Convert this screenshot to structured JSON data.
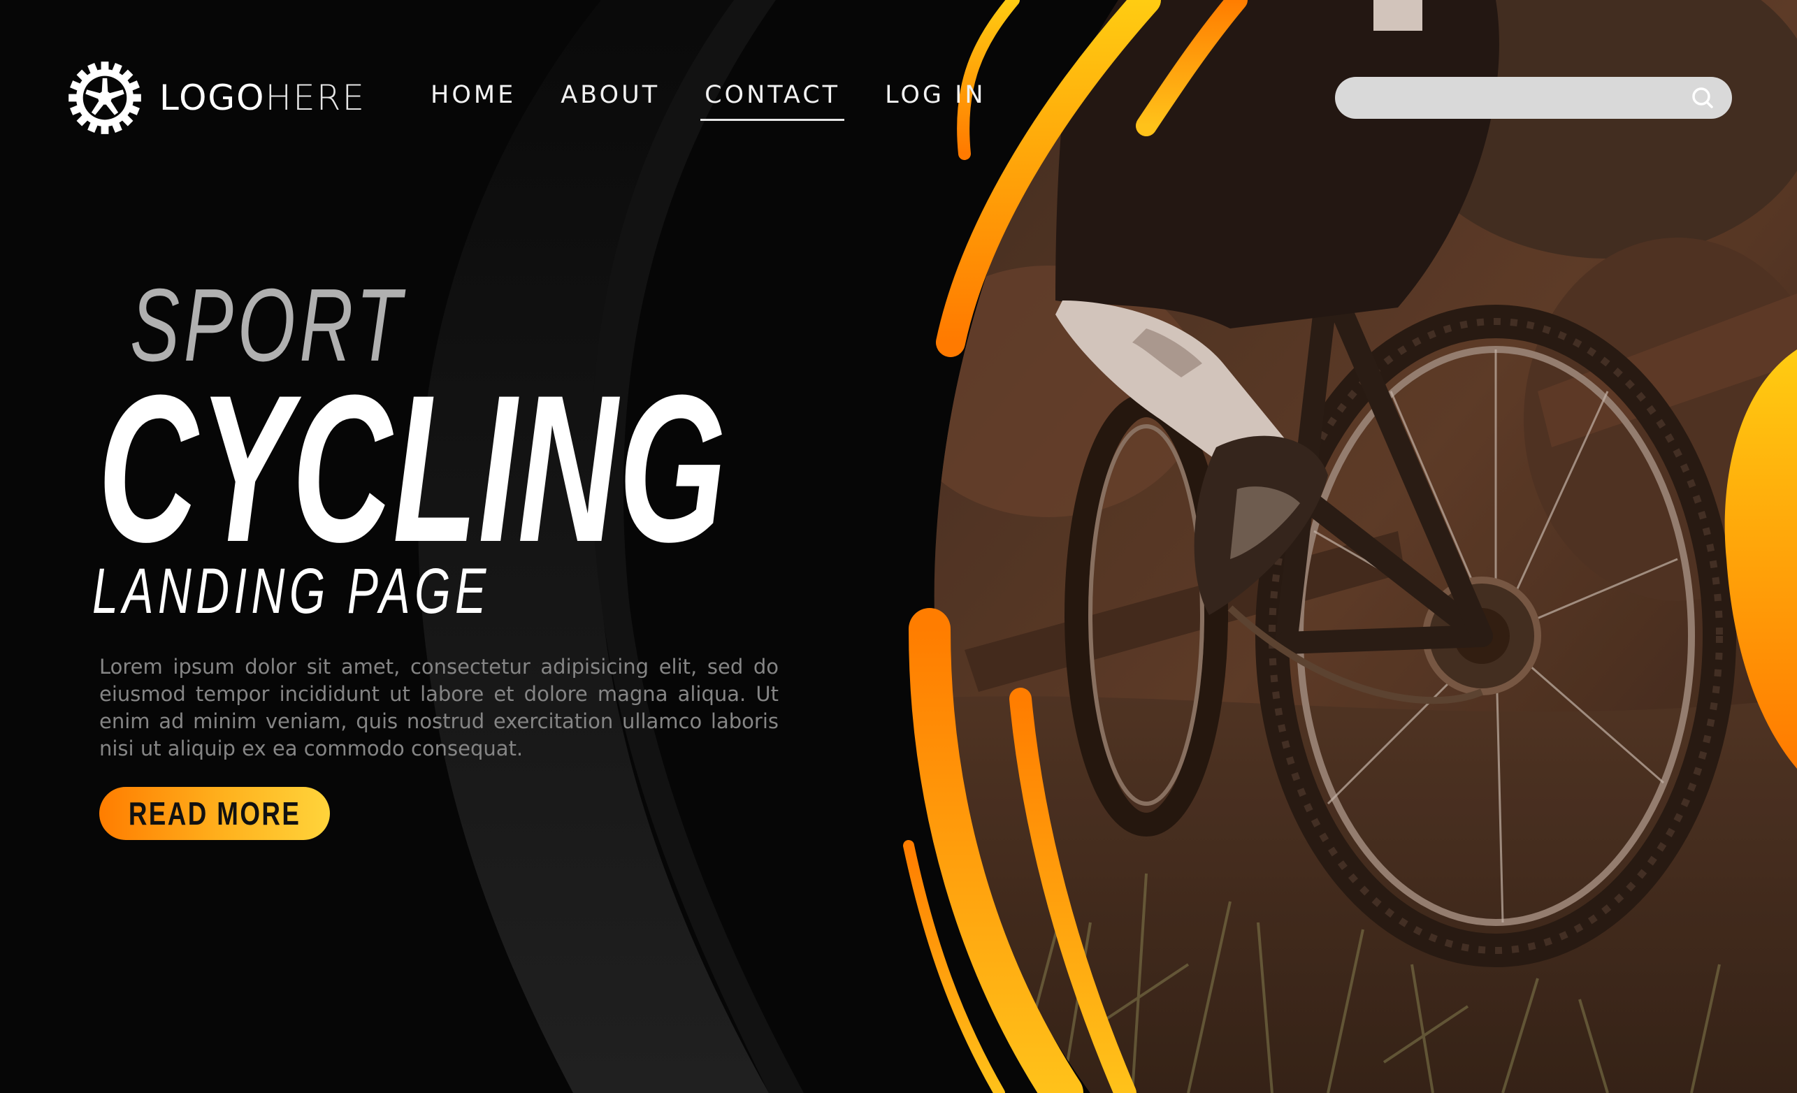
{
  "brand": {
    "logo_bold": "LOGO",
    "logo_light": "HERE"
  },
  "nav": {
    "items": [
      {
        "label": "HOME"
      },
      {
        "label": "ABOUT"
      },
      {
        "label": "CONTACT"
      },
      {
        "label": "LOG IN"
      }
    ],
    "active": "CONTACT"
  },
  "search": {
    "placeholder": "",
    "icon": "search-icon"
  },
  "hero": {
    "eyebrow": "SPORT",
    "title": "CYCLING",
    "subtitle": "LANDING PAGE",
    "body": "Lorem ipsum dolor sit amet, consectetur adipisicing elit, sed do eiusmod tempor incididunt ut labore et dolore magna aliqua. Ut enim ad minim veniam, quis nostrud exercitation ullamco laboris nisi ut aliquip ex ea commodo consequat.",
    "cta": "READ MORE"
  },
  "colors": {
    "background": "#060606",
    "accent_orange": "#ff7d00",
    "accent_yellow": "#ffd43b",
    "photo_tint": "#5a3522"
  }
}
